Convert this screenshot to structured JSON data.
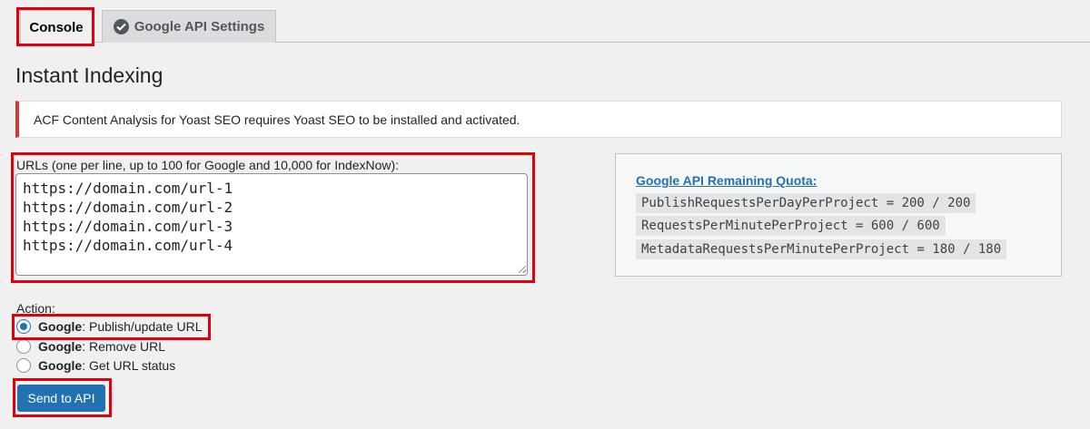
{
  "tabs": [
    {
      "label": "Console",
      "active": true
    },
    {
      "label": "Google API Settings",
      "icon": "check-circle-icon",
      "active": false
    }
  ],
  "page": {
    "title": "Instant Indexing"
  },
  "notice": {
    "text": "ACF Content Analysis for Yoast SEO requires Yoast SEO to be installed and activated.",
    "color": "#d63638"
  },
  "urls": {
    "label": "URLs (one per line, up to 100 for Google and 10,000 for IndexNow):",
    "value": "https://domain.com/url-1\nhttps://domain.com/url-2\nhttps://domain.com/url-3\nhttps://domain.com/url-4"
  },
  "quota": {
    "title": "Google API Remaining Quota:",
    "rows": [
      "PublishRequestsPerDayPerProject = 200 / 200",
      "RequestsPerMinutePerProject = 600 / 600",
      "MetadataRequestsPerMinutePerProject = 180 / 180"
    ]
  },
  "action": {
    "label": "Action:",
    "options": [
      {
        "provider": "Google",
        "text": ": Publish/update URL",
        "checked": true
      },
      {
        "provider": "Google",
        "text": ": Remove URL",
        "checked": false
      },
      {
        "provider": "Google",
        "text": ": Get URL status",
        "checked": false
      }
    ]
  },
  "submit": {
    "label": "Send to API",
    "color": "#2271b1"
  },
  "highlight_color": "#e0000b"
}
